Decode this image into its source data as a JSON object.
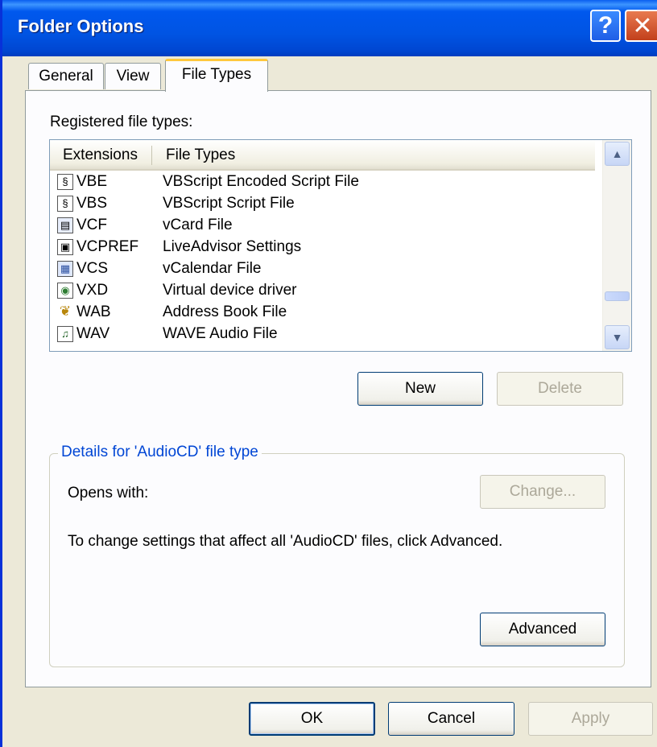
{
  "window": {
    "title": "Folder Options",
    "help_glyph": "?",
    "close_glyph": "✕"
  },
  "tabs": [
    {
      "label": "General",
      "active": false
    },
    {
      "label": "View",
      "active": false
    },
    {
      "label": "File Types",
      "active": true
    }
  ],
  "file_types": {
    "registered_label": "Registered file types:",
    "columns": [
      "Extensions",
      "File Types"
    ],
    "rows": [
      {
        "ext": "VBE",
        "type": "VBScript Encoded Script File",
        "icon": "script-icon"
      },
      {
        "ext": "VBS",
        "type": "VBScript Script File",
        "icon": "script-icon"
      },
      {
        "ext": "VCF",
        "type": "vCard File",
        "icon": "vcard-icon"
      },
      {
        "ext": "VCPREF",
        "type": "LiveAdvisor Settings",
        "icon": "settings-file-icon"
      },
      {
        "ext": "VCS",
        "type": "vCalendar File",
        "icon": "calendar-icon"
      },
      {
        "ext": "VXD",
        "type": "Virtual device driver",
        "icon": "driver-icon"
      },
      {
        "ext": "WAB",
        "type": "Address Book File",
        "icon": "address-book-icon"
      },
      {
        "ext": "WAV",
        "type": "WAVE Audio File",
        "icon": "audio-file-icon"
      }
    ],
    "new_label": "New",
    "delete_label": "Delete"
  },
  "details": {
    "legend": "Details for 'AudioCD' file type",
    "opens_with_label": "Opens with:",
    "change_label": "Change...",
    "description": "To change settings that affect all 'AudioCD' files, click Advanced.",
    "advanced_label": "Advanced"
  },
  "footer": {
    "ok_label": "OK",
    "cancel_label": "Cancel",
    "apply_label": "Apply"
  }
}
